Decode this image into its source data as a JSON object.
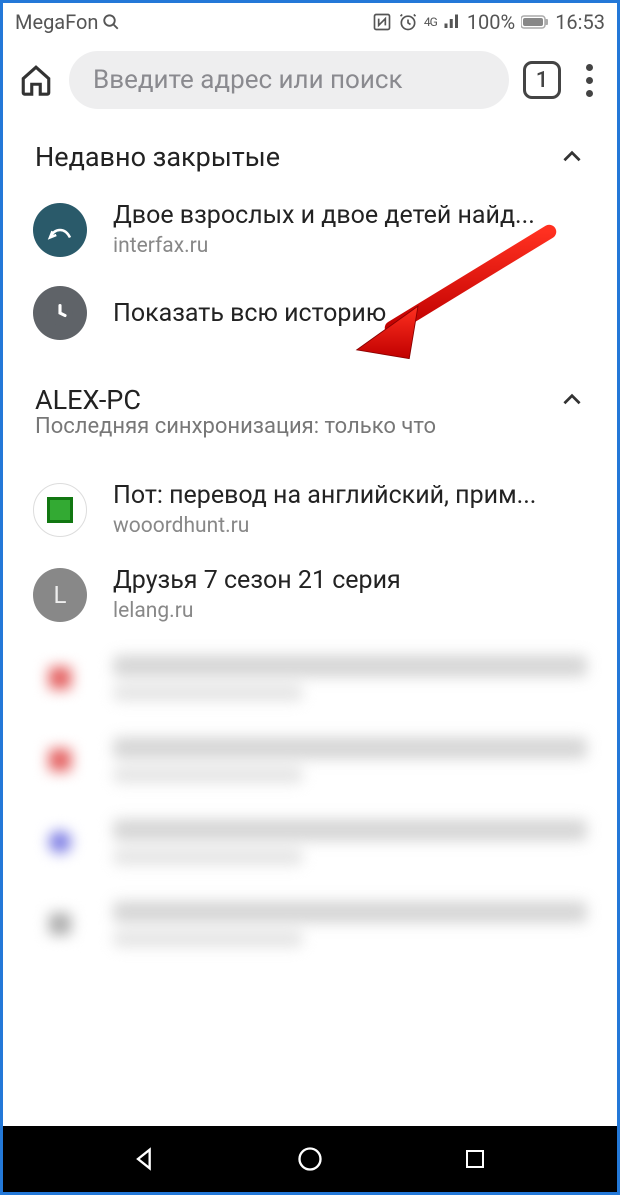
{
  "statusbar": {
    "carrier": "MegaFon",
    "signal": "4G",
    "battery": "100%",
    "time": "16:53"
  },
  "browser": {
    "omnibox_placeholder": "Введите адрес или поиск",
    "tab_count": "1"
  },
  "sections": {
    "recent": {
      "title": "Недавно закрытые",
      "items": [
        {
          "title": "Двое взрослых и двое детей найд...",
          "domain": "interfax.ru"
        }
      ],
      "show_all": "Показать всю историю"
    },
    "synced": {
      "title": "ALEX-PC",
      "subtitle": "Последняя синхронизация: только что",
      "items": [
        {
          "title": "Пот: перевод на английский, прим...",
          "domain": "wooordhunt.ru"
        },
        {
          "title": "Друзья 7 сезон 21 серия",
          "domain": "lelang.ru"
        }
      ]
    }
  }
}
